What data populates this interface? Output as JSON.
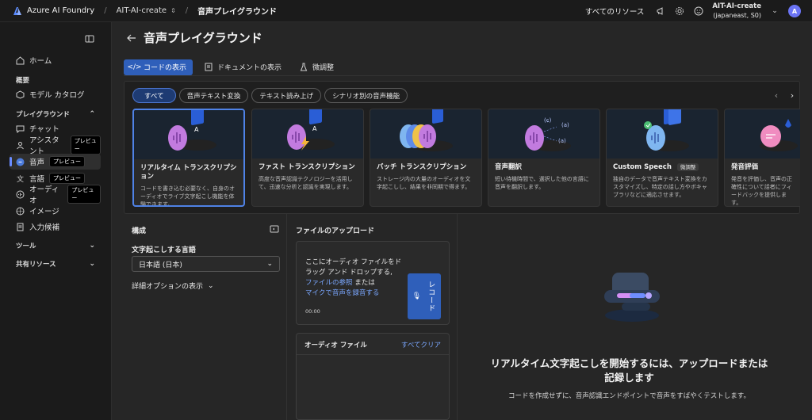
{
  "topbar": {
    "brand": "Azure AI Foundry",
    "project": "AIT-AI-create",
    "page": "音声プレイグラウンド",
    "all_resources": "すべてのリソース",
    "account_name": "AIT-AI-create",
    "account_region": "(japaneast, S0)",
    "avatar_letter": "A"
  },
  "sidebar": {
    "home": "ホーム",
    "overview_header": "概要",
    "model_catalog": "モデル カタログ",
    "playground_header": "プレイグラウンド",
    "chat": "チャット",
    "assistant": "アシスタント",
    "speech": "音声",
    "language": "言語",
    "audio": "オーディオ",
    "image": "イメージ",
    "completions": "入力候補",
    "tools_header": "ツール",
    "shared_header": "共有リソース",
    "preview_badge": "プレビュー"
  },
  "main": {
    "title": "音声プレイグラウンド",
    "toolbar": {
      "view_code": "コードの表示",
      "view_docs": "ドキュメントの表示",
      "fine_tune": "微調整"
    },
    "chips": [
      "すべて",
      "音声テキスト変換",
      "テキスト読み上げ",
      "シナリオ別の音声機能"
    ],
    "cards": [
      {
        "title": "リアルタイム トランスクリプション",
        "desc": "コードを書き込む必要なく、自身のオーディオでライブ文字起こし機能を体験できます。"
      },
      {
        "title": "ファスト トランスクリプション",
        "desc": "高度な音声認識テクノロジーを活用して、迅速な分析と認識を実現します。"
      },
      {
        "title": "バッチ トランスクリプション",
        "desc": "ストレージ内の大量のオーディオを文字起こしし、結果を非同期で得ます。"
      },
      {
        "title": "音声翻訳",
        "desc": "短い待機時間で、選択した他の言語に音声を翻訳します。"
      },
      {
        "title": "Custom Speech",
        "badge": "微調整",
        "desc": "独自のデータで音声テキスト変換をカスタマイズし、特定の話し方やボキャブラリなどに適応させます。"
      },
      {
        "title": "発音評価",
        "desc": "発音を評価し、音声の正確性について話者にフィードバックを提供します。"
      }
    ],
    "config": {
      "header": "構成",
      "lang_label": "文字起こしする言語",
      "lang_value": "日本語 (日本)",
      "advanced": "詳細オプションの表示"
    },
    "upload": {
      "header": "ファイルのアップロード",
      "drop_text": "ここにオーディオ ファイルをドラッグ アンド ドロップする,",
      "browse_link": "ファイルの参照",
      "or_text": " または",
      "mic_link": "マイクで音声を録音する",
      "timer": "00:00",
      "record": "レコード",
      "audio_files": "オーディオ ファイル",
      "clear_all": "すべてクリア"
    },
    "result": {
      "title": "リアルタイム文字起こしを開始するには、アップロードまたは記録します",
      "desc": "コードを作成せずに、音声認識エンドポイントで音声をすばやくテストします。"
    }
  }
}
